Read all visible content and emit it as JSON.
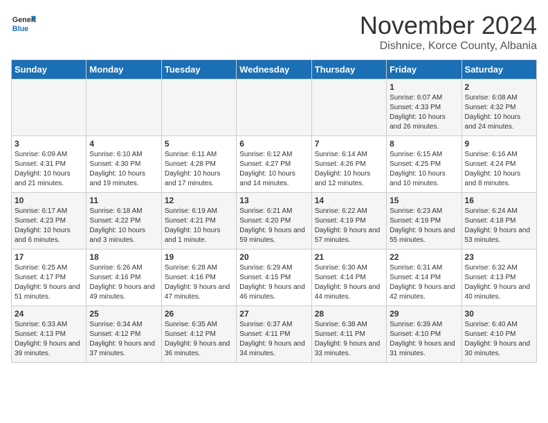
{
  "logo": {
    "general": "General",
    "blue": "Blue"
  },
  "header": {
    "month": "November 2024",
    "location": "Dishnice, Korce County, Albania"
  },
  "weekdays": [
    "Sunday",
    "Monday",
    "Tuesday",
    "Wednesday",
    "Thursday",
    "Friday",
    "Saturday"
  ],
  "weeks": [
    [
      {
        "day": "",
        "info": ""
      },
      {
        "day": "",
        "info": ""
      },
      {
        "day": "",
        "info": ""
      },
      {
        "day": "",
        "info": ""
      },
      {
        "day": "",
        "info": ""
      },
      {
        "day": "1",
        "info": "Sunrise: 6:07 AM\nSunset: 4:33 PM\nDaylight: 10 hours and 26 minutes."
      },
      {
        "day": "2",
        "info": "Sunrise: 6:08 AM\nSunset: 4:32 PM\nDaylight: 10 hours and 24 minutes."
      }
    ],
    [
      {
        "day": "3",
        "info": "Sunrise: 6:09 AM\nSunset: 4:31 PM\nDaylight: 10 hours and 21 minutes."
      },
      {
        "day": "4",
        "info": "Sunrise: 6:10 AM\nSunset: 4:30 PM\nDaylight: 10 hours and 19 minutes."
      },
      {
        "day": "5",
        "info": "Sunrise: 6:11 AM\nSunset: 4:28 PM\nDaylight: 10 hours and 17 minutes."
      },
      {
        "day": "6",
        "info": "Sunrise: 6:12 AM\nSunset: 4:27 PM\nDaylight: 10 hours and 14 minutes."
      },
      {
        "day": "7",
        "info": "Sunrise: 6:14 AM\nSunset: 4:26 PM\nDaylight: 10 hours and 12 minutes."
      },
      {
        "day": "8",
        "info": "Sunrise: 6:15 AM\nSunset: 4:25 PM\nDaylight: 10 hours and 10 minutes."
      },
      {
        "day": "9",
        "info": "Sunrise: 6:16 AM\nSunset: 4:24 PM\nDaylight: 10 hours and 8 minutes."
      }
    ],
    [
      {
        "day": "10",
        "info": "Sunrise: 6:17 AM\nSunset: 4:23 PM\nDaylight: 10 hours and 6 minutes."
      },
      {
        "day": "11",
        "info": "Sunrise: 6:18 AM\nSunset: 4:22 PM\nDaylight: 10 hours and 3 minutes."
      },
      {
        "day": "12",
        "info": "Sunrise: 6:19 AM\nSunset: 4:21 PM\nDaylight: 10 hours and 1 minute."
      },
      {
        "day": "13",
        "info": "Sunrise: 6:21 AM\nSunset: 4:20 PM\nDaylight: 9 hours and 59 minutes."
      },
      {
        "day": "14",
        "info": "Sunrise: 6:22 AM\nSunset: 4:19 PM\nDaylight: 9 hours and 57 minutes."
      },
      {
        "day": "15",
        "info": "Sunrise: 6:23 AM\nSunset: 4:19 PM\nDaylight: 9 hours and 55 minutes."
      },
      {
        "day": "16",
        "info": "Sunrise: 6:24 AM\nSunset: 4:18 PM\nDaylight: 9 hours and 53 minutes."
      }
    ],
    [
      {
        "day": "17",
        "info": "Sunrise: 6:25 AM\nSunset: 4:17 PM\nDaylight: 9 hours and 51 minutes."
      },
      {
        "day": "18",
        "info": "Sunrise: 6:26 AM\nSunset: 4:16 PM\nDaylight: 9 hours and 49 minutes."
      },
      {
        "day": "19",
        "info": "Sunrise: 6:28 AM\nSunset: 4:16 PM\nDaylight: 9 hours and 47 minutes."
      },
      {
        "day": "20",
        "info": "Sunrise: 6:29 AM\nSunset: 4:15 PM\nDaylight: 9 hours and 46 minutes."
      },
      {
        "day": "21",
        "info": "Sunrise: 6:30 AM\nSunset: 4:14 PM\nDaylight: 9 hours and 44 minutes."
      },
      {
        "day": "22",
        "info": "Sunrise: 6:31 AM\nSunset: 4:14 PM\nDaylight: 9 hours and 42 minutes."
      },
      {
        "day": "23",
        "info": "Sunrise: 6:32 AM\nSunset: 4:13 PM\nDaylight: 9 hours and 40 minutes."
      }
    ],
    [
      {
        "day": "24",
        "info": "Sunrise: 6:33 AM\nSunset: 4:13 PM\nDaylight: 9 hours and 39 minutes."
      },
      {
        "day": "25",
        "info": "Sunrise: 6:34 AM\nSunset: 4:12 PM\nDaylight: 9 hours and 37 minutes."
      },
      {
        "day": "26",
        "info": "Sunrise: 6:35 AM\nSunset: 4:12 PM\nDaylight: 9 hours and 36 minutes."
      },
      {
        "day": "27",
        "info": "Sunrise: 6:37 AM\nSunset: 4:11 PM\nDaylight: 9 hours and 34 minutes."
      },
      {
        "day": "28",
        "info": "Sunrise: 6:38 AM\nSunset: 4:11 PM\nDaylight: 9 hours and 33 minutes."
      },
      {
        "day": "29",
        "info": "Sunrise: 6:39 AM\nSunset: 4:10 PM\nDaylight: 9 hours and 31 minutes."
      },
      {
        "day": "30",
        "info": "Sunrise: 6:40 AM\nSunset: 4:10 PM\nDaylight: 9 hours and 30 minutes."
      }
    ]
  ]
}
